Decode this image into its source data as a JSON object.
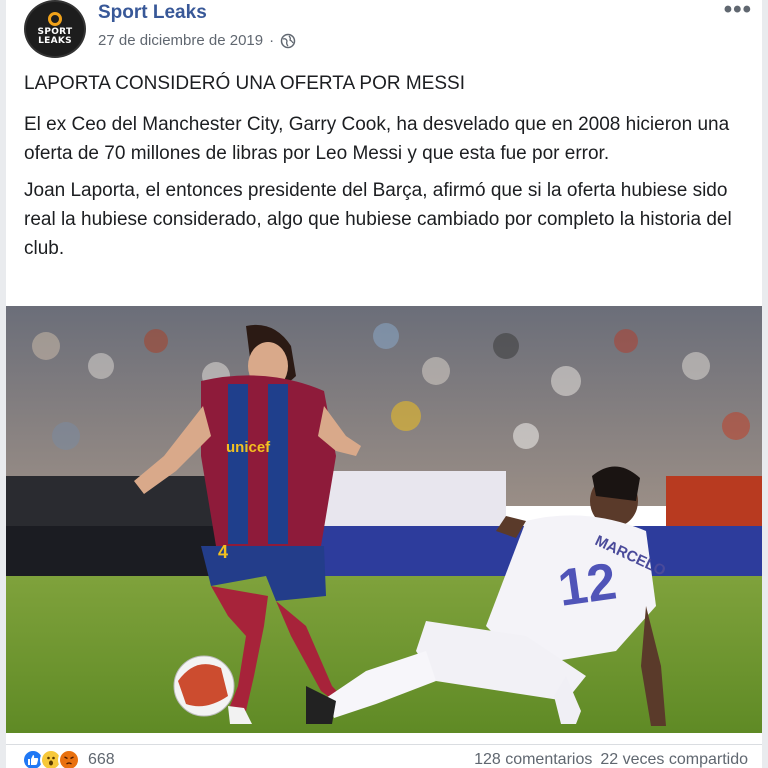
{
  "post": {
    "page_name": "Sport Leaks",
    "avatar_logo_text_1": "SPORT",
    "avatar_logo_text_2": "LEAKS",
    "date": "27 de diciembre de 2019",
    "meta_separator": "·",
    "more_label": "•••",
    "headline": "LAPORTA CONSIDERÓ UNA OFERTA POR MESSI",
    "paragraphs": [
      "El ex Ceo del Manchester City, Garry Cook, ha desvelado que en 2008 hicieron una oferta de 70 millones de libras por Leo Messi y que esta fue por error.",
      "Joan Laporta, el entonces presidente del Barça, afirmó que si la oferta hubiese sido real la hubiese considerado, algo que hubiese cambiado por completo la historia del club."
    ]
  },
  "photo": {
    "shirt_sponsor": "unicef",
    "player_shorts_number": "4",
    "opponent_number": "12",
    "opponent_name": "MARCELO"
  },
  "footer": {
    "reaction_count": "668",
    "comments": "128 comentarios",
    "shares": "22 veces compartido"
  },
  "colors": {
    "link_blue": "#385898",
    "secondary_text": "#606770",
    "like_blue": "#2078f4"
  },
  "icons": [
    "globe-icon",
    "more-icon",
    "like-icon",
    "wow-icon",
    "angry-icon"
  ]
}
